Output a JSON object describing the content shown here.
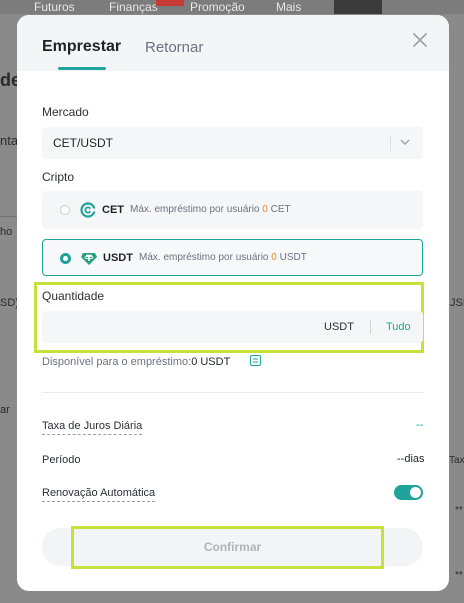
{
  "background": {
    "nav_items": [
      "Futuros",
      "Finanças",
      "Promoção",
      "Mais"
    ],
    "side_text_1": "de",
    "side_text_2": "nta",
    "side_text_3": "ho",
    "side_text_4": "SD)",
    "side_text_5": "ar",
    "right_text_1": "JSD",
    "right_text_2": "Taxa",
    "right_text_3": "**"
  },
  "modal": {
    "tabs": [
      {
        "label": "Emprestar",
        "active": true
      },
      {
        "label": "Retornar",
        "active": false
      }
    ],
    "market": {
      "label": "Mercado",
      "value": "CET/USDT"
    },
    "crypto": {
      "label": "Cripto",
      "options": [
        {
          "symbol": "CET",
          "info_prefix": "Máx. empréstimo por usuário",
          "max_amount": "0",
          "unit": "CET",
          "selected": false
        },
        {
          "symbol": "USDT",
          "info_prefix": "Máx. empréstimo por usuário",
          "max_amount": "0",
          "unit": "USDT",
          "selected": true
        }
      ]
    },
    "quantity": {
      "label": "Quantidade",
      "value": "",
      "unit": "USDT",
      "all_label": "Tudo"
    },
    "available": {
      "label": "Disponível para o empréstimo:",
      "amount": "0 USDT"
    },
    "daily_rate": {
      "label": "Taxa de Juros Diária",
      "value": "--"
    },
    "period": {
      "label": "Período",
      "value": "--dias"
    },
    "auto_renew": {
      "label": "Renovação Automática",
      "enabled": true
    },
    "confirm_label": "Confirmar"
  },
  "colors": {
    "accent": "#1fa39a",
    "highlight": "#c5e23a",
    "amount": "#f08a24"
  }
}
